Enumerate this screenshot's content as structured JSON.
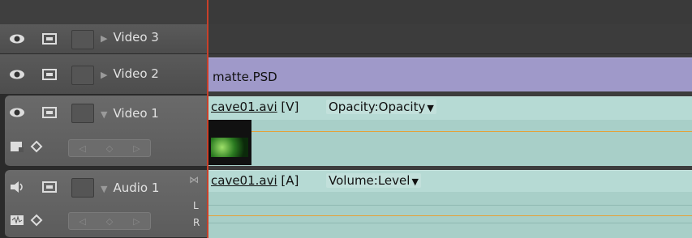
{
  "tracks": {
    "video3": {
      "label": "Video 3"
    },
    "video2": {
      "label": "Video 2",
      "clip": {
        "name": "matte.PSD"
      }
    },
    "video1": {
      "label": "Video 1",
      "clip": {
        "file": "cave01.avi",
        "tag": "[V]",
        "effect": "Opacity:Opacity"
      }
    },
    "audio1": {
      "label": "Audio 1",
      "clip": {
        "file": "cave01.avi",
        "tag": "[A]",
        "effect": "Volume:Level"
      },
      "channels": {
        "left": "L",
        "right": "R"
      }
    }
  },
  "colors": {
    "video_clip": "#9f99c9",
    "av_clip": "#a8cfc8",
    "playhead": "#c8402a",
    "keyframe_line": "#e4a23a"
  }
}
